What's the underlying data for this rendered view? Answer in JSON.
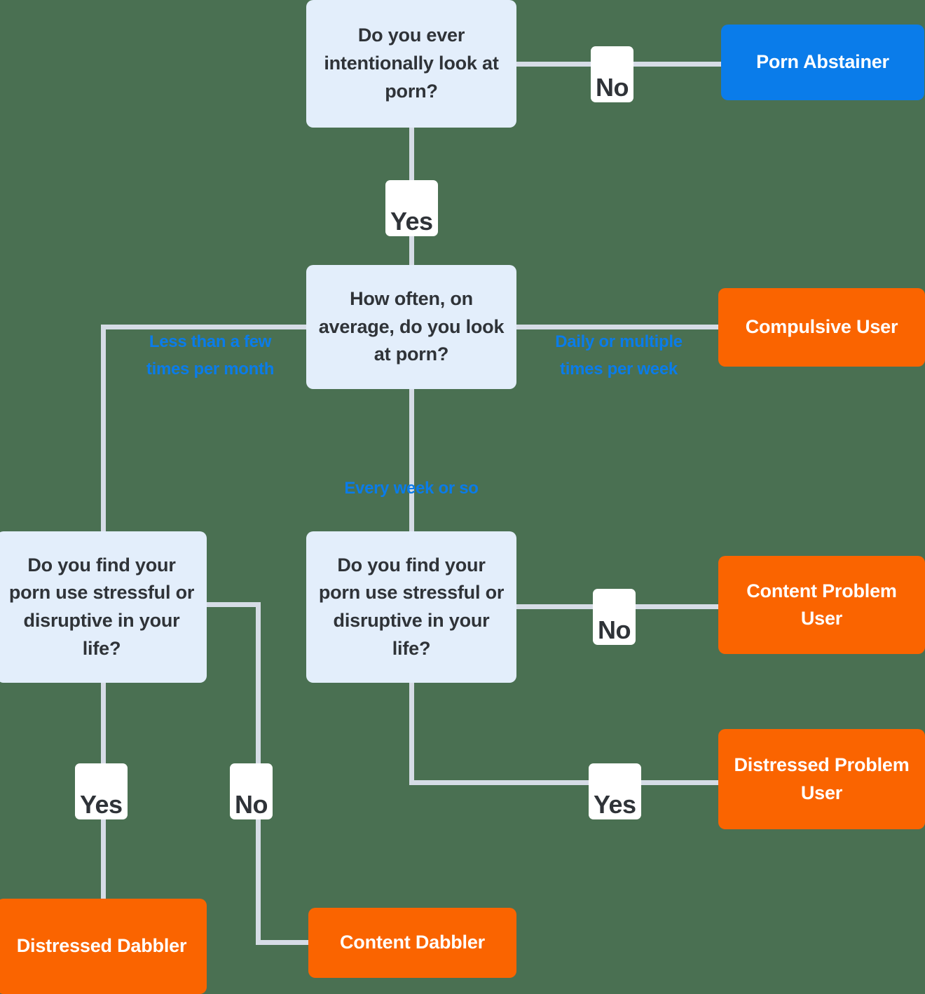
{
  "diagram": {
    "title": "Porn use decision tree",
    "colors": {
      "background": "#4a7052",
      "question_box": "#e3eefb",
      "outcome_blue": "#0a7cea",
      "outcome_orange": "#fa6400",
      "connector": "#d6dce6",
      "question_text": "#2f3338",
      "condition_label": "#0a7cea"
    },
    "nodes": {
      "q_look_at_porn": "Do you ever intentionally look at porn?",
      "q_how_often": "How often, on average, do you look at porn?",
      "q_stressful_left": "Do you find your porn use stressful or disruptive in your life?",
      "q_stressful_mid": "Do you find your porn use stressful or disruptive in your life?",
      "out_porn_abstainer": "Porn Abstainer",
      "out_compulsive_user": "Compulsive User",
      "out_content_problem_user": "Content Problem User",
      "out_distressed_problem_user": "Distressed Problem User",
      "out_distressed_dabbler": "Distressed Dabbler",
      "out_content_dabbler": "Content Dabbler"
    },
    "edges": {
      "no_abstainer": "No",
      "yes_how_often": "Yes",
      "less_than_few_per_month": "Less than a few\ntimes per month",
      "daily_or_multiple_per_week": "Daily or multiple\ntimes per week",
      "every_week_or_so": "Every week or so",
      "no_content_problem": "No",
      "yes_distressed_problem": "Yes",
      "yes_distressed_dabbler": "Yes",
      "no_content_dabbler": "No"
    }
  }
}
